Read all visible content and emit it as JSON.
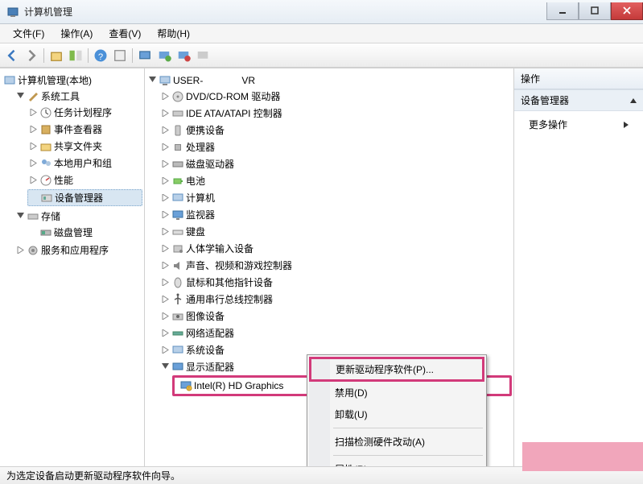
{
  "window": {
    "title": "计算机管理"
  },
  "menu": {
    "file": "文件(F)",
    "action": "操作(A)",
    "view": "查看(V)",
    "help": "帮助(H)"
  },
  "toolbar": {
    "back": "back",
    "forward": "forward",
    "up": "up",
    "show_hide": "show-hide",
    "help": "help",
    "properties": "properties",
    "scan": "scan",
    "remote": "remote",
    "uninstall": "uninstall",
    "enable": "enable",
    "update": "update"
  },
  "left_tree": {
    "root": "计算机管理(本地)",
    "system_tools": "系统工具",
    "task_scheduler": "任务计划程序",
    "event_viewer": "事件查看器",
    "shared_folders": "共享文件夹",
    "local_users": "本地用户和组",
    "performance": "性能",
    "device_manager": "设备管理器",
    "storage": "存储",
    "disk_mgmt": "磁盘管理",
    "services_apps": "服务和应用程序"
  },
  "mid_tree": {
    "root": "USER-　　　　VR",
    "dvd": "DVD/CD-ROM 驱动器",
    "ide": "IDE ATA/ATAPI 控制器",
    "portable": "便携设备",
    "cpu": "处理器",
    "disk": "磁盘驱动器",
    "battery": "电池",
    "computer": "计算机",
    "monitor": "监视器",
    "keyboard": "键盘",
    "hid": "人体学输入设备",
    "sound": "声音、视频和游戏控制器",
    "mouse": "鼠标和其他指针设备",
    "usb": "通用串行总线控制器",
    "imaging": "图像设备",
    "network": "网络适配器",
    "system": "系统设备",
    "display": "显示适配器",
    "gpu": "Intel(R) HD Graphics"
  },
  "context": {
    "update": "更新驱动程序软件(P)...",
    "disable": "禁用(D)",
    "uninstall": "卸载(U)",
    "scan": "扫描检测硬件改动(A)",
    "properties": "属性(R)"
  },
  "actions_pane": {
    "header": "操作",
    "group": "设备管理器",
    "more": "更多操作"
  },
  "status": "为选定设备启动更新驱动程序软件向导。"
}
